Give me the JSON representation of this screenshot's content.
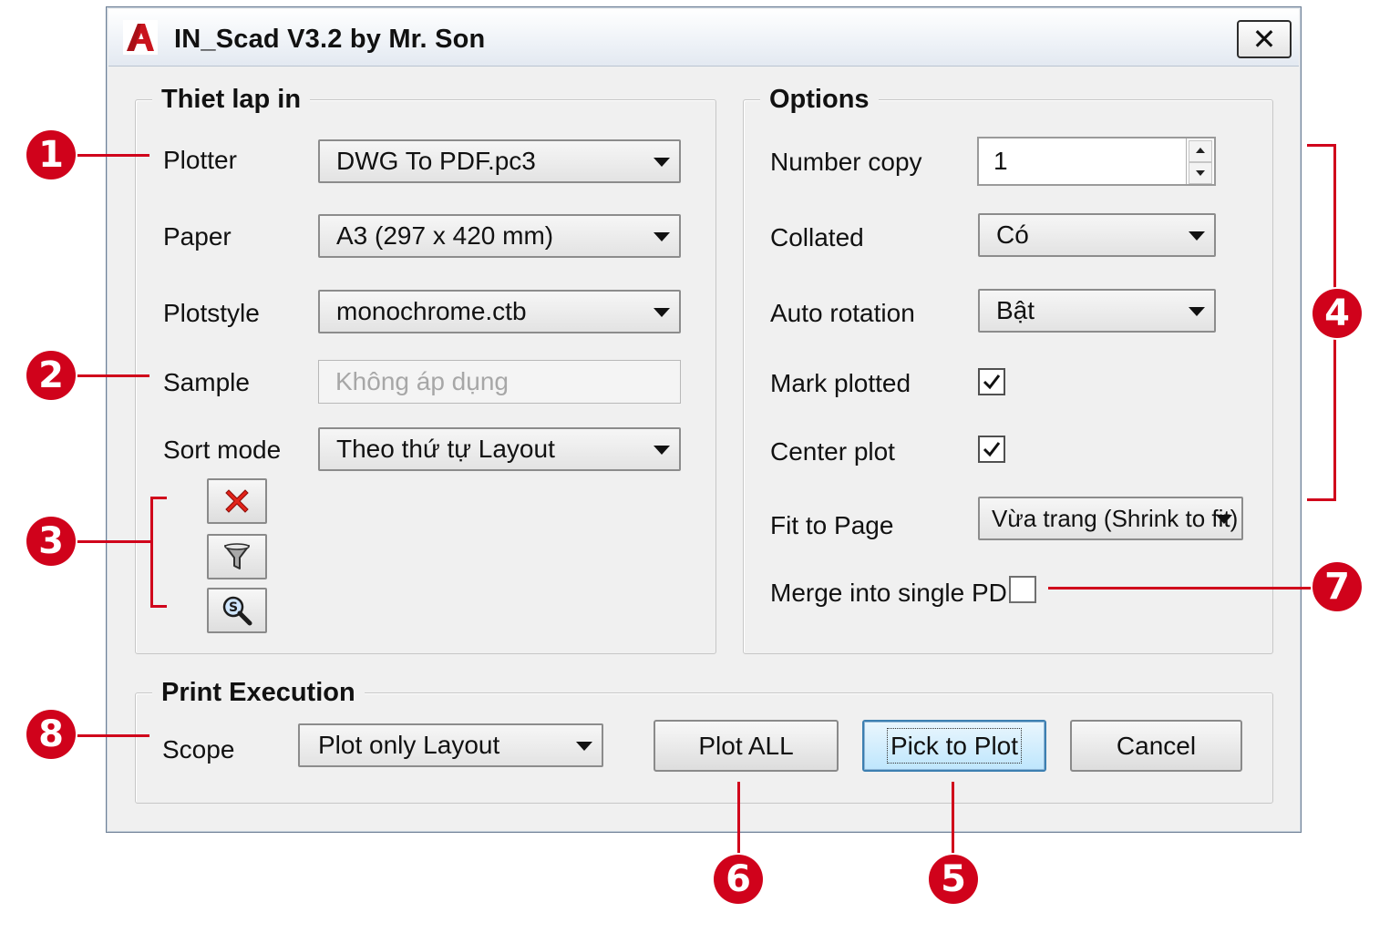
{
  "window": {
    "title": "IN_Scad V3.2 by Mr. Son",
    "close_symbol": "✕",
    "app_icon": "autocad-logo-icon"
  },
  "plot_setup": {
    "group_title": "Thiet lap in",
    "plotter": {
      "label": "Plotter",
      "value": "DWG To PDF.pc3"
    },
    "paper": {
      "label": "Paper",
      "value": "A3 (297 x 420 mm)"
    },
    "plotstyle": {
      "label": "Plotstyle",
      "value": "monochrome.ctb"
    },
    "sample": {
      "label": "Sample",
      "value": "Không áp dụng"
    },
    "sort_mode": {
      "label": "Sort mode",
      "value": "Theo thứ tự Layout"
    },
    "tools": [
      "delete-icon",
      "filter-icon",
      "search-icon"
    ]
  },
  "options": {
    "group_title": "Options",
    "number_copy": {
      "label": "Number copy",
      "value": "1"
    },
    "collated": {
      "label": "Collated",
      "value": "Có"
    },
    "auto_rotation": {
      "label": "Auto rotation",
      "value": "Bật"
    },
    "mark_plotted": {
      "label": "Mark plotted",
      "checked": true
    },
    "center_plot": {
      "label": "Center plot",
      "checked": true
    },
    "fit_to_page": {
      "label": "Fit to Page",
      "value": "Vừa trang (Shrink to fit)"
    },
    "merge_pdf": {
      "label": "Merge into single PDF",
      "checked": false
    }
  },
  "execution": {
    "group_title": "Print Execution",
    "scope": {
      "label": "Scope",
      "value": "Plot only Layout"
    },
    "plot_all_label": "Plot ALL",
    "pick_to_plot_label": "Pick to Plot",
    "cancel_label": "Cancel"
  },
  "callouts": {
    "c1": "1",
    "c2": "2",
    "c3": "3",
    "c4": "4",
    "c5": "5",
    "c6": "6",
    "c7": "7",
    "c8": "8"
  },
  "colors": {
    "callout": "#d0021b",
    "default_button": "#3c7fb1",
    "dialog_bg": "#f0f0f0"
  }
}
